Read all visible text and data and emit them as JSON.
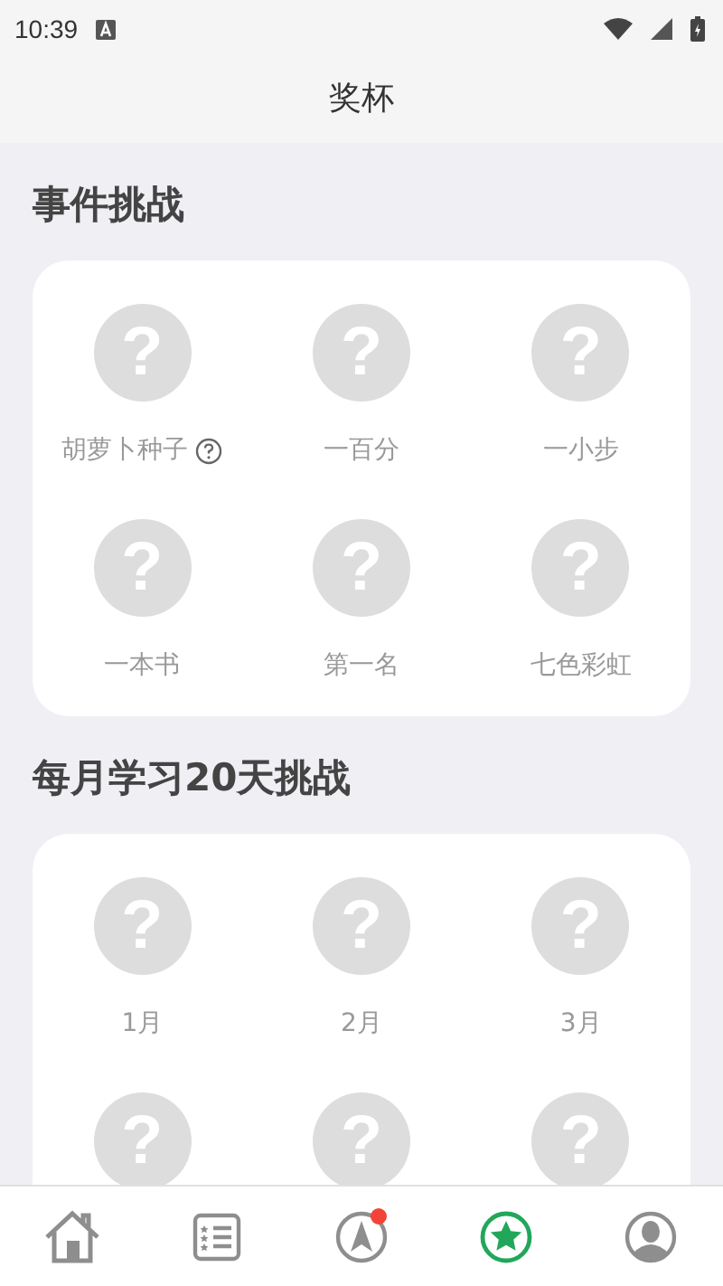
{
  "status_bar": {
    "time": "10:39"
  },
  "title": "奖杯",
  "sections": [
    {
      "title": "事件挑战",
      "badges": [
        {
          "symbol": "?",
          "label": "胡萝卜种子",
          "locked": true,
          "help": true
        },
        {
          "symbol": "?",
          "label": "一百分",
          "locked": true
        },
        {
          "symbol": "?",
          "label": "一小步",
          "locked": true
        },
        {
          "symbol": "?",
          "label": "一本书",
          "locked": true
        },
        {
          "symbol": "?",
          "label": "第一名",
          "locked": true
        },
        {
          "symbol": "?",
          "label": "七色彩虹",
          "locked": true
        }
      ]
    },
    {
      "title": "每月学习20天挑战",
      "badges": [
        {
          "symbol": "?",
          "label": "1月",
          "locked": true
        },
        {
          "symbol": "?",
          "label": "2月",
          "locked": true
        },
        {
          "symbol": "?",
          "label": "3月",
          "locked": true
        },
        {
          "symbol": "?",
          "locked": true
        },
        {
          "symbol": "?",
          "locked": true
        },
        {
          "symbol": "?",
          "locked": true
        }
      ]
    }
  ],
  "tabs": [
    {
      "kind": "home",
      "selected": false
    },
    {
      "kind": "list",
      "selected": false
    },
    {
      "kind": "compass",
      "selected": false,
      "dot": true
    },
    {
      "kind": "star",
      "selected": true
    },
    {
      "kind": "profile",
      "selected": false
    }
  ]
}
